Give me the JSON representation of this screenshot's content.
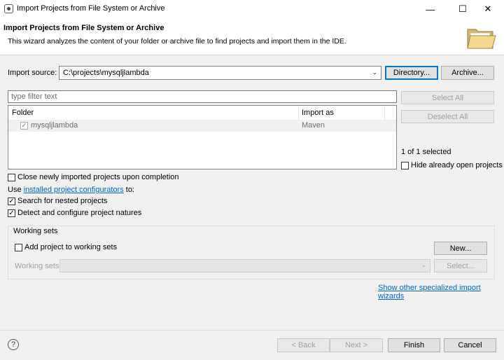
{
  "window": {
    "title": "Import Projects from File System or Archive",
    "minimize": "—",
    "maximize": "☐",
    "close": "✕"
  },
  "header": {
    "title": "Import Projects from File System or Archive",
    "description": "This wizard analyzes the content of your folder or archive file to find projects and import them in the IDE."
  },
  "import_source": {
    "label": "Import source:",
    "value": "C:\\projects\\mysqljlambda",
    "directory_button": "Directory...",
    "archive_button": "Archive..."
  },
  "filter": {
    "placeholder": "type filter text"
  },
  "table": {
    "columns": [
      "Folder",
      "Import as"
    ],
    "rows": [
      {
        "folder": "mysqljlambda",
        "import_as": "Maven",
        "checked": true
      }
    ]
  },
  "side": {
    "select_all": "Select All",
    "deselect_all": "Deselect All",
    "selected_count": "1 of 1 selected",
    "hide_open": "Hide already open projects"
  },
  "options": {
    "close_new": "Close newly imported projects upon completion",
    "use_prefix": "Use ",
    "use_link": "installed project configurators",
    "use_suffix": " to:",
    "search_nested": "Search for nested projects",
    "detect_natures": "Detect and configure project natures"
  },
  "working_sets": {
    "legend": "Working sets",
    "add_label": "Add project to working sets",
    "new_button": "New...",
    "sets_label": "Working sets:",
    "select_button": "Select..."
  },
  "link_specialized": "Show other specialized import wizards",
  "footer": {
    "back": "< Back",
    "next": "Next >",
    "finish": "Finish",
    "cancel": "Cancel",
    "help": "?"
  }
}
